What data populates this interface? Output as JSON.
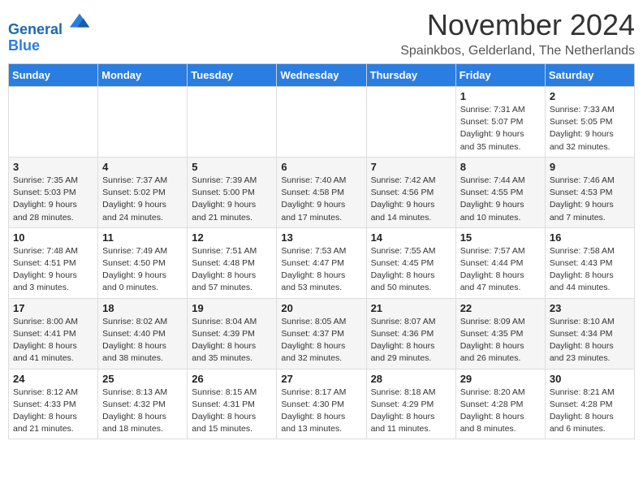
{
  "header": {
    "logo_line1": "General",
    "logo_line2": "Blue",
    "month_title": "November 2024",
    "subtitle": "Spainkbos, Gelderland, The Netherlands"
  },
  "weekdays": [
    "Sunday",
    "Monday",
    "Tuesday",
    "Wednesday",
    "Thursday",
    "Friday",
    "Saturday"
  ],
  "weeks": [
    [
      {
        "day": "",
        "detail": ""
      },
      {
        "day": "",
        "detail": ""
      },
      {
        "day": "",
        "detail": ""
      },
      {
        "day": "",
        "detail": ""
      },
      {
        "day": "",
        "detail": ""
      },
      {
        "day": "1",
        "detail": "Sunrise: 7:31 AM\nSunset: 5:07 PM\nDaylight: 9 hours\nand 35 minutes."
      },
      {
        "day": "2",
        "detail": "Sunrise: 7:33 AM\nSunset: 5:05 PM\nDaylight: 9 hours\nand 32 minutes."
      }
    ],
    [
      {
        "day": "3",
        "detail": "Sunrise: 7:35 AM\nSunset: 5:03 PM\nDaylight: 9 hours\nand 28 minutes."
      },
      {
        "day": "4",
        "detail": "Sunrise: 7:37 AM\nSunset: 5:02 PM\nDaylight: 9 hours\nand 24 minutes."
      },
      {
        "day": "5",
        "detail": "Sunrise: 7:39 AM\nSunset: 5:00 PM\nDaylight: 9 hours\nand 21 minutes."
      },
      {
        "day": "6",
        "detail": "Sunrise: 7:40 AM\nSunset: 4:58 PM\nDaylight: 9 hours\nand 17 minutes."
      },
      {
        "day": "7",
        "detail": "Sunrise: 7:42 AM\nSunset: 4:56 PM\nDaylight: 9 hours\nand 14 minutes."
      },
      {
        "day": "8",
        "detail": "Sunrise: 7:44 AM\nSunset: 4:55 PM\nDaylight: 9 hours\nand 10 minutes."
      },
      {
        "day": "9",
        "detail": "Sunrise: 7:46 AM\nSunset: 4:53 PM\nDaylight: 9 hours\nand 7 minutes."
      }
    ],
    [
      {
        "day": "10",
        "detail": "Sunrise: 7:48 AM\nSunset: 4:51 PM\nDaylight: 9 hours\nand 3 minutes."
      },
      {
        "day": "11",
        "detail": "Sunrise: 7:49 AM\nSunset: 4:50 PM\nDaylight: 9 hours\nand 0 minutes."
      },
      {
        "day": "12",
        "detail": "Sunrise: 7:51 AM\nSunset: 4:48 PM\nDaylight: 8 hours\nand 57 minutes."
      },
      {
        "day": "13",
        "detail": "Sunrise: 7:53 AM\nSunset: 4:47 PM\nDaylight: 8 hours\nand 53 minutes."
      },
      {
        "day": "14",
        "detail": "Sunrise: 7:55 AM\nSunset: 4:45 PM\nDaylight: 8 hours\nand 50 minutes."
      },
      {
        "day": "15",
        "detail": "Sunrise: 7:57 AM\nSunset: 4:44 PM\nDaylight: 8 hours\nand 47 minutes."
      },
      {
        "day": "16",
        "detail": "Sunrise: 7:58 AM\nSunset: 4:43 PM\nDaylight: 8 hours\nand 44 minutes."
      }
    ],
    [
      {
        "day": "17",
        "detail": "Sunrise: 8:00 AM\nSunset: 4:41 PM\nDaylight: 8 hours\nand 41 minutes."
      },
      {
        "day": "18",
        "detail": "Sunrise: 8:02 AM\nSunset: 4:40 PM\nDaylight: 8 hours\nand 38 minutes."
      },
      {
        "day": "19",
        "detail": "Sunrise: 8:04 AM\nSunset: 4:39 PM\nDaylight: 8 hours\nand 35 minutes."
      },
      {
        "day": "20",
        "detail": "Sunrise: 8:05 AM\nSunset: 4:37 PM\nDaylight: 8 hours\nand 32 minutes."
      },
      {
        "day": "21",
        "detail": "Sunrise: 8:07 AM\nSunset: 4:36 PM\nDaylight: 8 hours\nand 29 minutes."
      },
      {
        "day": "22",
        "detail": "Sunrise: 8:09 AM\nSunset: 4:35 PM\nDaylight: 8 hours\nand 26 minutes."
      },
      {
        "day": "23",
        "detail": "Sunrise: 8:10 AM\nSunset: 4:34 PM\nDaylight: 8 hours\nand 23 minutes."
      }
    ],
    [
      {
        "day": "24",
        "detail": "Sunrise: 8:12 AM\nSunset: 4:33 PM\nDaylight: 8 hours\nand 21 minutes."
      },
      {
        "day": "25",
        "detail": "Sunrise: 8:13 AM\nSunset: 4:32 PM\nDaylight: 8 hours\nand 18 minutes."
      },
      {
        "day": "26",
        "detail": "Sunrise: 8:15 AM\nSunset: 4:31 PM\nDaylight: 8 hours\nand 15 minutes."
      },
      {
        "day": "27",
        "detail": "Sunrise: 8:17 AM\nSunset: 4:30 PM\nDaylight: 8 hours\nand 13 minutes."
      },
      {
        "day": "28",
        "detail": "Sunrise: 8:18 AM\nSunset: 4:29 PM\nDaylight: 8 hours\nand 11 minutes."
      },
      {
        "day": "29",
        "detail": "Sunrise: 8:20 AM\nSunset: 4:28 PM\nDaylight: 8 hours\nand 8 minutes."
      },
      {
        "day": "30",
        "detail": "Sunrise: 8:21 AM\nSunset: 4:28 PM\nDaylight: 8 hours\nand 6 minutes."
      }
    ]
  ]
}
